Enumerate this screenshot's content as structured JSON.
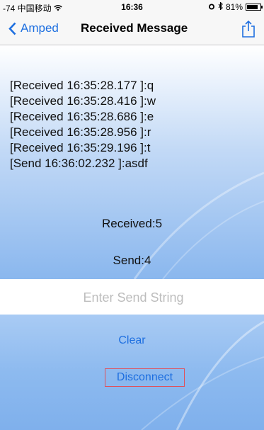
{
  "status_bar": {
    "carrier": "-74 中国移动",
    "time": "16:36",
    "battery": "81%",
    "battery_level": 0.81
  },
  "nav": {
    "back_label": "Amped",
    "title": "Received Message"
  },
  "log_lines": [
    "[Received 16:35:28.177 ]:q",
    "[Received 16:35:28.416 ]:w",
    "[Received 16:35:28.686 ]:e",
    "[Received 16:35:28.956 ]:r",
    "[Received 16:35:29.196 ]:t",
    "[Send 16:36:02.232 ]:asdf"
  ],
  "counters": {
    "received": "Received:5",
    "send": "Send:4"
  },
  "input": {
    "placeholder": "Enter Send String",
    "value": ""
  },
  "buttons": {
    "clear": "Clear",
    "disconnect": "Disconnect"
  },
  "icons": [
    "wifi-icon",
    "alarm-icon",
    "bluetooth-icon",
    "battery-icon",
    "chevron-left-icon",
    "share-icon"
  ],
  "colors": {
    "accent": "#1e6fe0",
    "highlight_border": "#e0505a"
  }
}
